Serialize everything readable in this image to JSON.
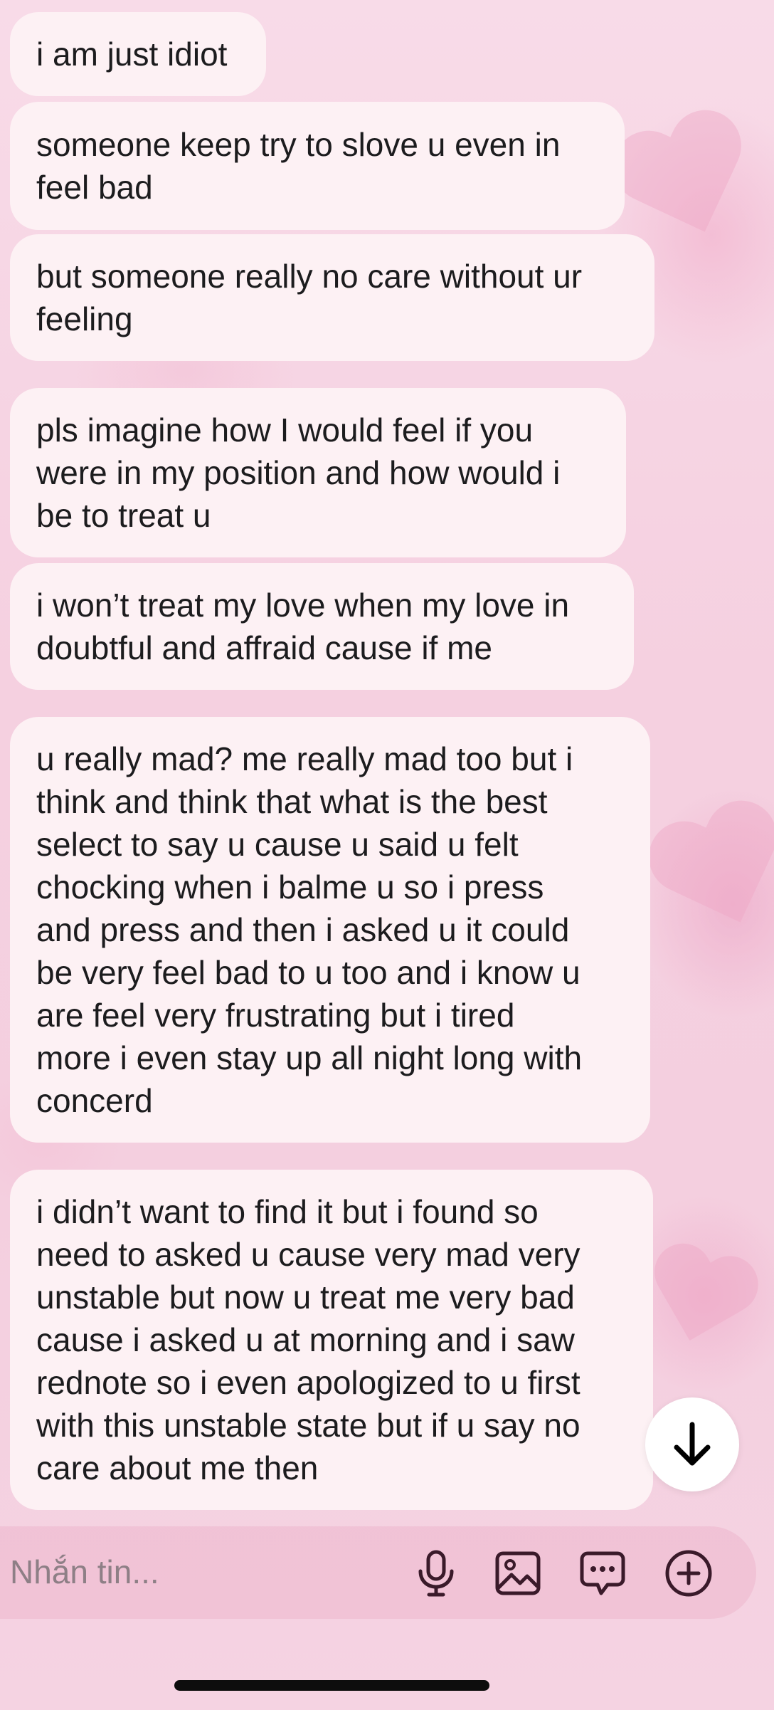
{
  "messages": [
    {
      "text": "i am just idiot"
    },
    {
      "text": "someone keep try to slove u even in\nfeel bad"
    },
    {
      "text": "but someone really no care without ur\nfeeling"
    },
    {
      "text": "pls imagine how I would feel if you\nwere in my position and how would i\nbe to treat u"
    },
    {
      "text": "i won’t treat my love when my love in\ndoubtful and affraid cause if me"
    },
    {
      "text": "u really mad? me really mad too but i\nthink and think that what is the best\nselect to say u cause u said u felt\nchocking when i balme u so i press\nand press and then i asked u it could\nbe very feel bad to u too and i know u\nare feel very frustrating  but i tired\nmore i even stay up all night long with\nconcerd"
    },
    {
      "text": "i didn’t want to find it but i found so\nneed to asked u cause very mad very\nunstable but now u treat me very bad\ncause i asked u at morning and i saw\nrednote so i even apologized to u first\nwith this unstable state but if u say no\ncare about me then"
    }
  ],
  "composer": {
    "placeholder": "Nhắn tin...",
    "icons": [
      "microphone-icon",
      "image-icon",
      "chat-bubble-icon",
      "plus-circle-icon"
    ]
  },
  "scroll_button": {
    "icon": "arrow-down-icon"
  },
  "colors": {
    "background": "#f6d3e2",
    "bubble": "#fdf1f4",
    "text": "#1c1c1e",
    "icon": "#3a1a2a"
  }
}
